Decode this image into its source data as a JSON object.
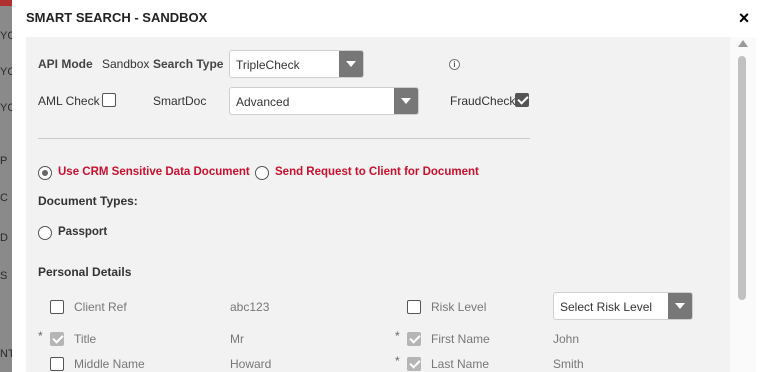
{
  "modal": {
    "title": "SMART SEARCH - SANDBOX",
    "close": "×"
  },
  "backdrop_labels": [
    "YC",
    "YC",
    "YC",
    "P",
    "C",
    "D",
    "S",
    "NT"
  ],
  "api_mode": {
    "label": "API Mode",
    "value": "Sandbox"
  },
  "search_type": {
    "label": "Search Type",
    "selected": "TripleCheck",
    "info_icon": "i"
  },
  "aml_check": {
    "label": "AML Check",
    "checked": false
  },
  "smartdoc": {
    "label": "SmartDoc",
    "selected": "Advanced"
  },
  "fraud_check": {
    "label": "FraudCheck",
    "checked": true
  },
  "document_source": {
    "options": [
      {
        "label": "Use CRM Sensitive Data Document",
        "selected": true
      },
      {
        "label": "Send Request to Client for Document",
        "selected": false
      }
    ]
  },
  "document_types": {
    "heading": "Document Types:",
    "options": [
      {
        "label": "Passport",
        "selected": false
      }
    ]
  },
  "personal_details": {
    "heading": "Personal Details",
    "required_marker": "*",
    "rows": [
      {
        "left": {
          "label": "Client Ref",
          "value": "abc123",
          "checked": false,
          "required": false
        },
        "right": {
          "label": "Risk Level",
          "select": "Select Risk Level",
          "checked": false,
          "required": false
        }
      },
      {
        "left": {
          "label": "Title",
          "value": "Mr",
          "checked": true,
          "required": true
        },
        "right": {
          "label": "First Name",
          "value": "John",
          "checked": true,
          "required": true
        }
      },
      {
        "left": {
          "label": "Middle Name",
          "value": "Howard",
          "checked": false,
          "required": false
        },
        "right": {
          "label": "Last Name",
          "value": "Smith",
          "checked": true,
          "required": true
        }
      }
    ]
  },
  "colors": {
    "accent_red": "#c8102e",
    "panel_bg": "#f2f2f2",
    "dropdown_arrow_bg": "#777777"
  }
}
